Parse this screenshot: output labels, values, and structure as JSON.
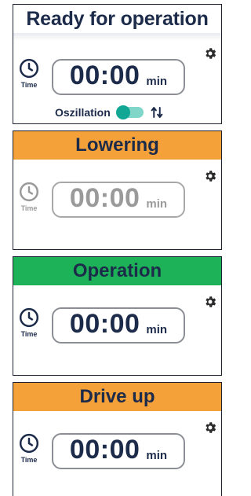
{
  "panels": [
    {
      "title": "Ready for operation",
      "time_label": "Time",
      "timer_value": "00:00",
      "timer_unit": "min",
      "oscillation_label": "Oszillation",
      "oscillation_on": true
    },
    {
      "title": "Lowering",
      "time_label": "Time",
      "timer_value": "00:00",
      "timer_unit": "min"
    },
    {
      "title": "Operation",
      "time_label": "Time",
      "timer_value": "00:00",
      "timer_unit": "min"
    },
    {
      "title": "Drive up",
      "time_label": "Time",
      "timer_value": "00:00",
      "timer_unit": "min"
    }
  ],
  "colors": {
    "ready_header": "#ffffff",
    "lowering_header": "#f4a13a",
    "operation_header": "#1db158",
    "drive_up_header": "#f4a13a",
    "text_dark": "#1d2b4a",
    "toggle_on": "#12a795"
  },
  "icons": [
    "clock-icon",
    "gear-icon",
    "swap-vertical-icon"
  ]
}
